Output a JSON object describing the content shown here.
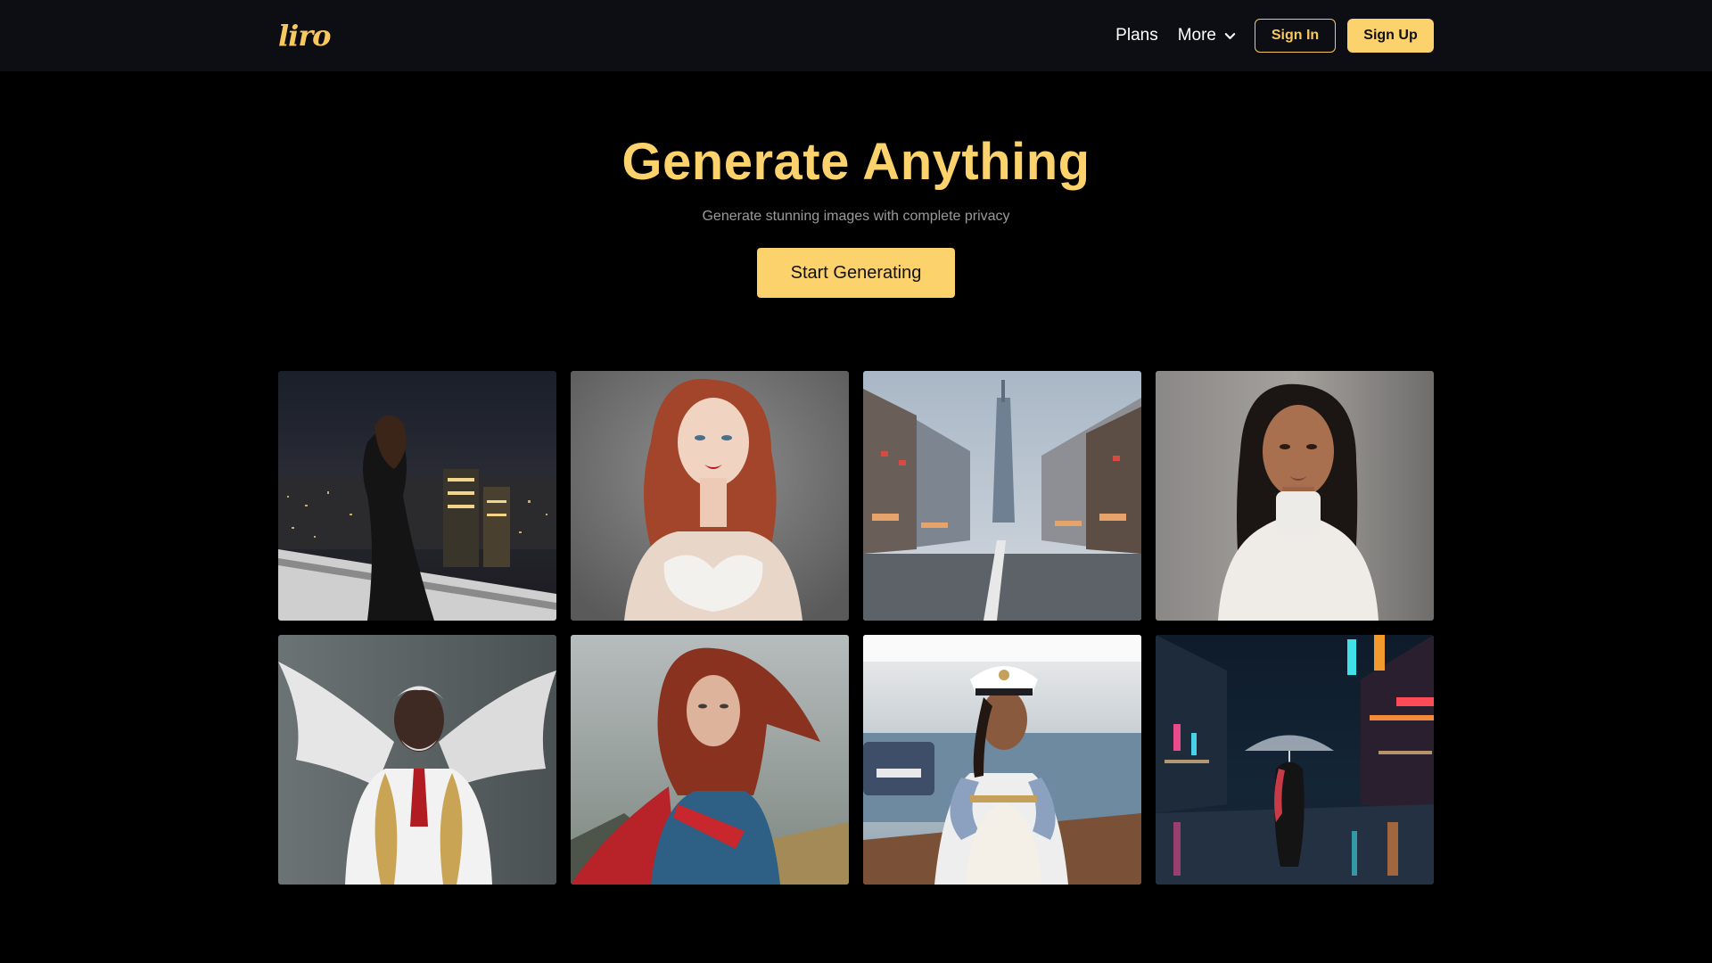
{
  "nav": {
    "logo": "liro",
    "plans": "Plans",
    "more": "More",
    "sign_in": "Sign In",
    "sign_up": "Sign Up"
  },
  "hero": {
    "title": "Generate Anything",
    "subtitle": "Generate stunning images with complete privacy",
    "cta": "Start Generating"
  },
  "gallery": {
    "images": [
      {
        "subject": "woman on rooftop over night city"
      },
      {
        "subject": "red-haired woman portrait"
      },
      {
        "subject": "empty city street with tower"
      },
      {
        "subject": "woman in white top portrait"
      },
      {
        "subject": "winged man in white suit"
      },
      {
        "subject": "red-haired superhero woman"
      },
      {
        "subject": "woman captain on yacht"
      },
      {
        "subject": "woman with umbrella on neon street"
      }
    ]
  },
  "colors": {
    "accent": "#fbd26b",
    "navbar_bg": "#0c0e13",
    "page_bg": "#000000"
  }
}
